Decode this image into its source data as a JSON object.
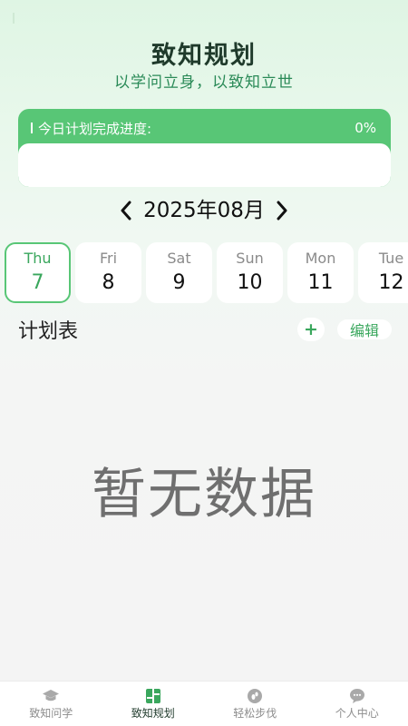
{
  "header": {
    "title": "致知规划",
    "slogan": "以学问立身，以致知立世"
  },
  "progress": {
    "label": "今日计划完成进度:",
    "value_text": "0%",
    "fraction": 0,
    "accent": "#58c676"
  },
  "calendar": {
    "month_label": "2025年08月",
    "prev_icon": "chevron-left-icon",
    "next_icon": "chevron-right-icon",
    "days": [
      {
        "weekday": "Thu",
        "day": "7",
        "selected": true
      },
      {
        "weekday": "Fri",
        "day": "8",
        "selected": false
      },
      {
        "weekday": "Sat",
        "day": "9",
        "selected": false
      },
      {
        "weekday": "Sun",
        "day": "10",
        "selected": false
      },
      {
        "weekday": "Mon",
        "day": "11",
        "selected": false
      },
      {
        "weekday": "Tue",
        "day": "12",
        "selected": false
      }
    ]
  },
  "plan": {
    "title": "计划表",
    "add_label": "+",
    "edit_label": "编辑"
  },
  "empty_text": "暂无数据",
  "tabs": [
    {
      "label": "致知问学",
      "icon": "graduation-cap-icon",
      "active": false
    },
    {
      "label": "致知规划",
      "icon": "book-plan-icon",
      "active": true
    },
    {
      "label": "轻松步伐",
      "icon": "footsteps-icon",
      "active": false
    },
    {
      "label": "个人中心",
      "icon": "chat-bubble-icon",
      "active": false
    }
  ]
}
